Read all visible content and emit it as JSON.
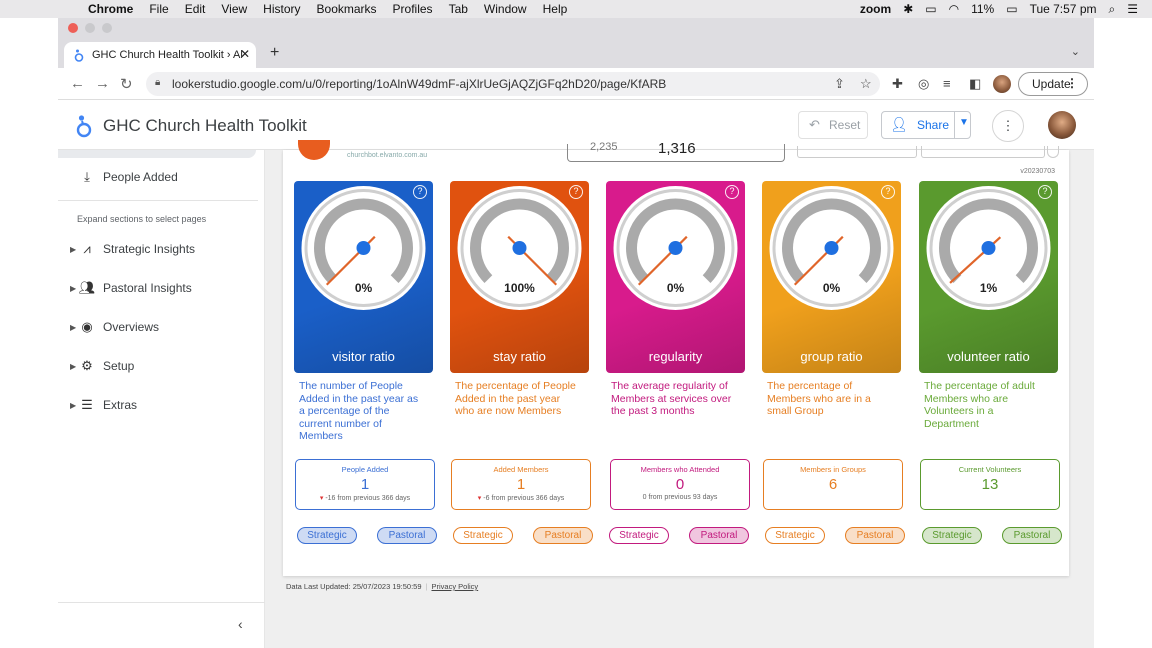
{
  "menubar": {
    "app": "Chrome",
    "items": [
      "File",
      "Edit",
      "View",
      "History",
      "Bookmarks",
      "Profiles",
      "Tab",
      "Window",
      "Help"
    ],
    "zoom": "zoom",
    "battery": "11%",
    "clock": "Tue 7:57 pm"
  },
  "browser": {
    "tab_title": "GHC Church Health Toolkit › Al",
    "url": "lookerstudio.google.com/u/0/reporting/1oAlnW49dmF-ajXlrUeGjAQZjGFq2hD20/page/KfARB",
    "update_label": "Update"
  },
  "app": {
    "title": "GHC Church Health Toolkit",
    "reset_label": "Reset",
    "share_label": "Share"
  },
  "sidebar": {
    "people_added": "People Added",
    "hint": "Expand sections to select pages",
    "sections": [
      {
        "label": "Strategic Insights",
        "icon": "trend-icon"
      },
      {
        "label": "Pastoral Insights",
        "icon": "people-icon"
      },
      {
        "label": "Overviews",
        "icon": "eye-icon"
      },
      {
        "label": "Setup",
        "icon": "gear-icon"
      },
      {
        "label": "Extras",
        "icon": "list-icon"
      }
    ]
  },
  "report": {
    "org_url": "churchbot.elvanto.com.au",
    "kpi_left": "2,235",
    "kpi_right": "1,316",
    "version": "v20230703",
    "footer_updated": "Data Last Updated: 25/07/2023 19:50:59",
    "footer_privacy": "Privacy Policy",
    "gauges": [
      {
        "name": "visitor ratio",
        "value": "0%",
        "percent": 0,
        "color": "#1a5fc8",
        "text_color": "#3b6fd4",
        "desc": "The number of People Added in the past year as a percentage of the current number of Members",
        "stat_title": "People Added",
        "stat_value": "1",
        "stat_change": "-16",
        "stat_change_text": "from previous 366 days",
        "stat_color": "#3b6fd4"
      },
      {
        "name": "stay ratio",
        "value": "100%",
        "percent": 100,
        "color": "#e0520f",
        "text_color": "#e67e22",
        "desc": "The percentage of People Added in the past year who are now Members",
        "stat_title": "Added Members",
        "stat_value": "1",
        "stat_change": "-6",
        "stat_change_text": "from previous 366 days",
        "stat_color": "#e67e22"
      },
      {
        "name": "regularity",
        "value": "0%",
        "percent": 0,
        "color": "#d81b8c",
        "text_color": "#c21a7e",
        "desc": "The average regularity of Members at services over the past 3 months",
        "stat_title": "Members who Attended",
        "stat_value": "0",
        "stat_change": "0",
        "stat_change_text": "from previous 93 days",
        "stat_color": "#c21a7e"
      },
      {
        "name": "group ratio",
        "value": "0%",
        "percent": 0,
        "color": "#f0a01c",
        "text_color": "#e67e22",
        "desc": "The percentage of Members who are in a small Group",
        "stat_title": "Members in Groups",
        "stat_value": "6",
        "stat_change": "",
        "stat_change_text": "",
        "stat_color": "#e67e22"
      },
      {
        "name": "volunteer ratio",
        "value": "1%",
        "percent": 1,
        "color": "#5a9a2e",
        "text_color": "#6aaa3a",
        "desc": "The percentage of adult Members who are Volunteers in a Department",
        "stat_title": "Current Volunteers",
        "stat_value": "13",
        "stat_change": "",
        "stat_change_text": "",
        "stat_color": "#5a9a2e"
      }
    ],
    "pill_strategic": "Strategic",
    "pill_pastoral": "Pastoral"
  }
}
